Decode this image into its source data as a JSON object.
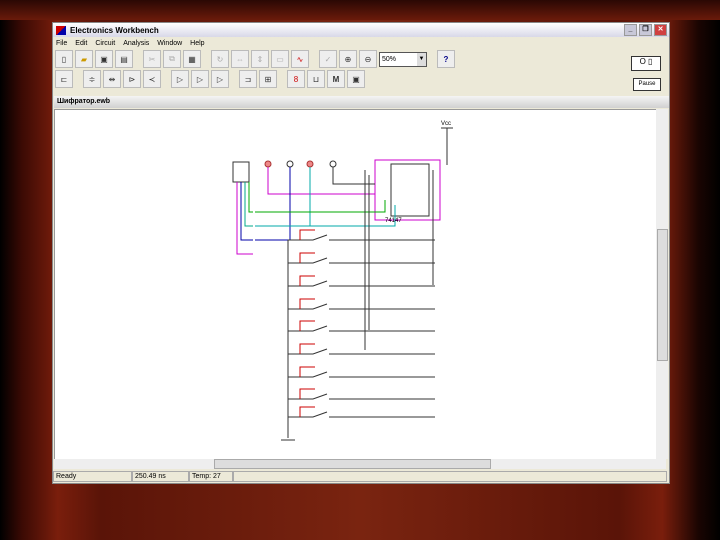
{
  "window": {
    "title": "Electronics Workbench",
    "minimize": "_",
    "restore": "❐",
    "close": "✕"
  },
  "menu": [
    "File",
    "Edit",
    "Circuit",
    "Analysis",
    "Window",
    "Help"
  ],
  "toolbar": {
    "zoom_value": "50%",
    "help_label": "?"
  },
  "side": {
    "power_label": "O ▯",
    "pause_label": "Pause"
  },
  "document": {
    "title": "Шифратор.ewb"
  },
  "circuit": {
    "chip_label": "74147",
    "vcc_label": "Vcc"
  },
  "status": {
    "state": "Ready",
    "time": "250.49 ns",
    "temp": "Temp: 27"
  }
}
